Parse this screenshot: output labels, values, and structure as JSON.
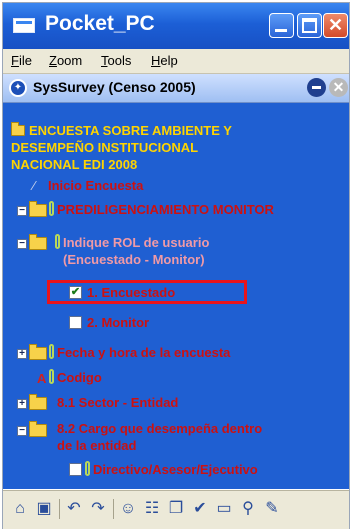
{
  "window": {
    "title": "Pocket_PC",
    "minimize_icon": "minimize-icon",
    "maximize_icon": "maximize-icon",
    "close_glyph": "✕"
  },
  "menu": {
    "file": {
      "accel": "F",
      "rest": "ile"
    },
    "zoom": {
      "accel": "Z",
      "rest": "oom"
    },
    "tools": {
      "accel": "T",
      "rest": "ools"
    },
    "help": {
      "accel": "H",
      "rest": "elp"
    }
  },
  "header": {
    "title": "SysSurvey  (Censo 2005)",
    "close_glyph": "✕"
  },
  "tree": {
    "root_label_1": "ENCUESTA SOBRE AMBIENTE Y",
    "root_label_2": "DESEMPEÑO INSTITUCIONAL",
    "root_label_3": "NACIONAL EDI 2008",
    "inicio": "Inicio Encuesta",
    "predil": "PREDILIGENCIAMIENTO MONITOR",
    "rol_1": "Indique ROL de usuario",
    "rol_2": "(Encuestado - Monitor)",
    "opt_encuestado": "1. Encuestado",
    "opt_monitor": "2. Monitor",
    "fecha": "Fecha y hora de la encuesta",
    "codigo": "Codigo",
    "sector": "8.1 Sector - Entidad",
    "cargo_1": "8.2 Cargo que desempeña dentro",
    "cargo_2": "de la entidad",
    "directivo": "Directivo/Asesor/Ejecutivo"
  },
  "colors": {
    "title_bar": "#1c5fd6",
    "content_bg": "#1f5fd2",
    "label_red": "#cc1111",
    "label_yellow": "#ffd400",
    "highlight": "#e8141c"
  },
  "toolbar": {
    "icons": [
      "home-icon",
      "save-icon",
      "undo-icon",
      "redo-icon",
      "user-icon",
      "tree-icon",
      "copy-icon",
      "check-icon",
      "folder-icon",
      "search-icon",
      "edit-icon"
    ]
  }
}
